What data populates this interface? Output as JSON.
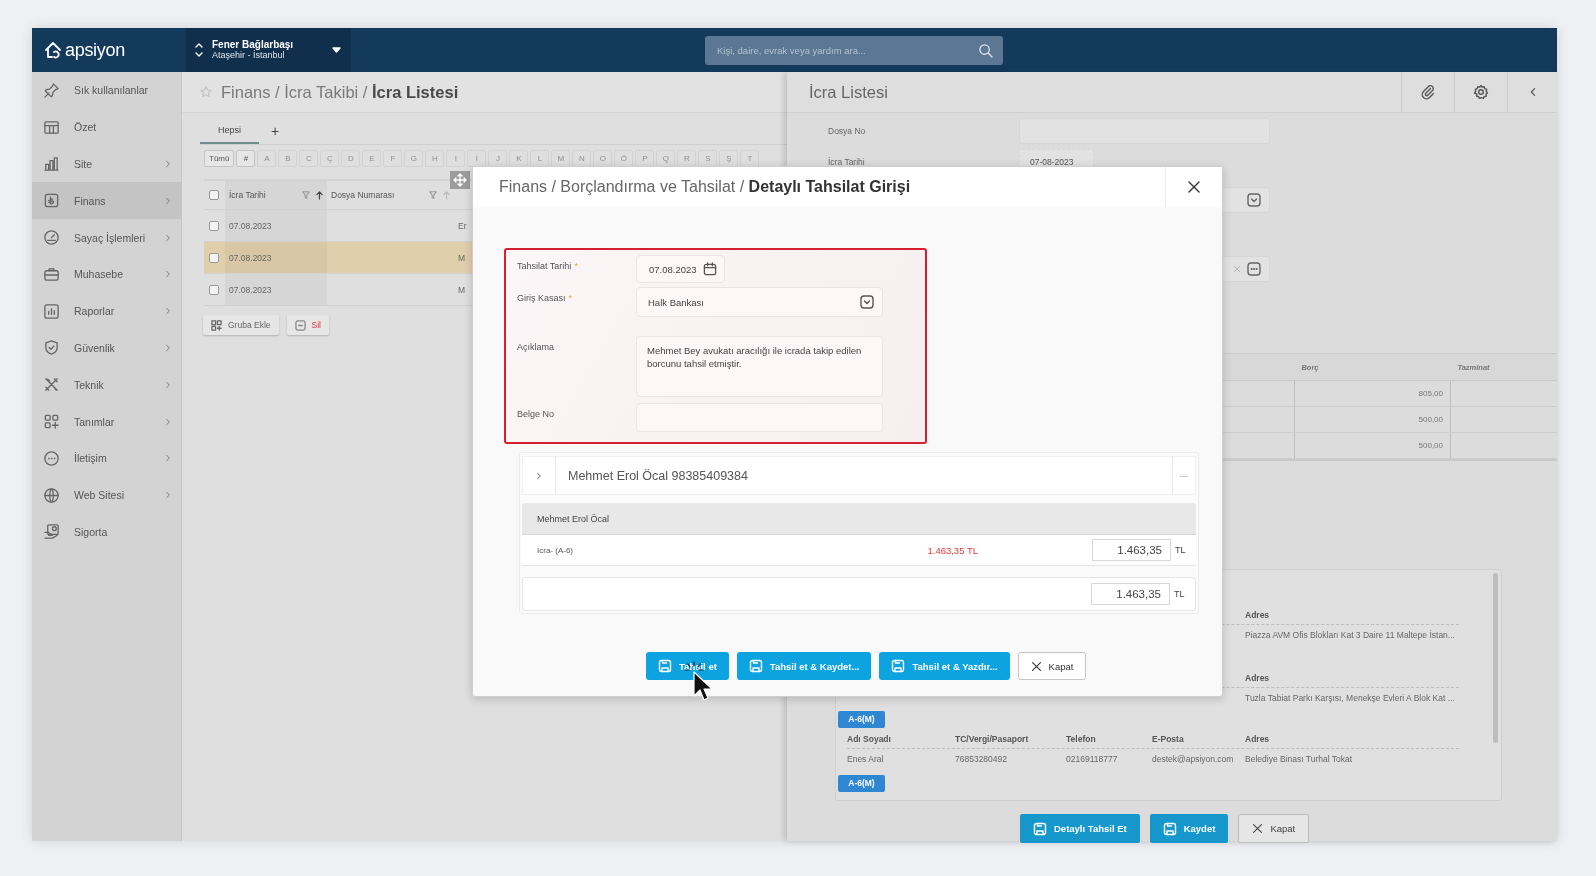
{
  "topbar": {
    "logo": "apsiyon",
    "site": {
      "name": "Fener Bağlarbaşı",
      "location": "Ataşehir - İstanbul"
    },
    "search": {
      "placeholder": "Kişi, daire, evrak veya yardım ara..."
    }
  },
  "sidebar": {
    "items": [
      {
        "label": "Sık kullanılanlar",
        "expandable": false,
        "selected": false
      },
      {
        "label": "Özet",
        "expandable": false,
        "selected": false
      },
      {
        "label": "Site",
        "expandable": true,
        "selected": false
      },
      {
        "label": "Finans",
        "expandable": true,
        "selected": true
      },
      {
        "label": "Sayaç İşlemleri",
        "expandable": true,
        "selected": false
      },
      {
        "label": "Muhasebe",
        "expandable": true,
        "selected": false
      },
      {
        "label": "Raporlar",
        "expandable": true,
        "selected": false
      },
      {
        "label": "Güvenlik",
        "expandable": true,
        "selected": false
      },
      {
        "label": "Teknik",
        "expandable": true,
        "selected": false
      },
      {
        "label": "Tanımlar",
        "expandable": true,
        "selected": false
      },
      {
        "label": "İletişim",
        "expandable": true,
        "selected": false
      },
      {
        "label": "Web Sitesi",
        "expandable": true,
        "selected": false
      },
      {
        "label": "Sigorta",
        "expandable": false,
        "selected": false
      }
    ]
  },
  "list_panel": {
    "breadcrumb": "Finans / İcra Takibi / **İcra Listesi**",
    "tabs": [
      {
        "label": "Hepsi",
        "selected": true
      }
    ],
    "add_tab": "+",
    "letters": [
      {
        "label": "Tümü",
        "disabled": false
      },
      {
        "label": "#",
        "disabled": false
      },
      {
        "label": "A",
        "disabled": true
      },
      {
        "label": "B",
        "disabled": true
      },
      {
        "label": "C",
        "disabled": true
      },
      {
        "label": "Ç",
        "disabled": true
      },
      {
        "label": "D",
        "disabled": true
      },
      {
        "label": "E",
        "disabled": true
      },
      {
        "label": "F",
        "disabled": true
      },
      {
        "label": "G",
        "disabled": true
      },
      {
        "label": "H",
        "disabled": true
      },
      {
        "label": "I",
        "disabled": true
      },
      {
        "label": "İ",
        "disabled": true
      },
      {
        "label": "J",
        "disabled": true
      },
      {
        "label": "K",
        "disabled": true
      },
      {
        "label": "L",
        "disabled": true
      },
      {
        "label": "M",
        "disabled": true
      },
      {
        "label": "N",
        "disabled": true
      },
      {
        "label": "O",
        "disabled": true
      },
      {
        "label": "Ö",
        "disabled": true
      },
      {
        "label": "P",
        "disabled": true
      },
      {
        "label": "Q",
        "disabled": true
      },
      {
        "label": "R",
        "disabled": true
      },
      {
        "label": "S",
        "disabled": true
      },
      {
        "label": "Ş",
        "disabled": true
      },
      {
        "label": "T",
        "disabled": true
      }
    ],
    "table": {
      "select_all": {
        "checked": false
      },
      "columns": [
        "İcra Tarihi",
        "Dosya Numarası"
      ],
      "rows": [
        {
          "date": "07.08.2023",
          "column_3": "Er",
          "checked": false,
          "selected": false
        },
        {
          "date": "07.08.2023",
          "column_3": "M",
          "checked": false,
          "selected": true
        },
        {
          "date": "07.08.2023",
          "column_3": "M",
          "checked": false,
          "selected": false
        }
      ]
    },
    "buttons": [
      {
        "label": "Gruba Ekle",
        "kind": "neutral"
      },
      {
        "label": "Sil",
        "kind": "danger"
      }
    ]
  },
  "detail_panel": {
    "title": "İcra Listesi",
    "fields": [
      {
        "label": "Dosya No"
      },
      {
        "label": "İcra Tarihi",
        "value": "07-08-2023"
      }
    ],
    "table": {
      "columns": [
        "Borç",
        "Tazminat"
      ],
      "rows": [
        {
          "debt": "805,00"
        },
        {
          "debt": "500,00"
        },
        {
          "debt": "500,00"
        }
      ]
    },
    "contacts": [
      {
        "columns": [
          "Adres"
        ],
        "rows": [
          [
            "Piazza AVM Ofis Blokları Kat 3 Daire 11 Maltepe İstan..."
          ]
        ]
      },
      {
        "columns": [
          "Adres"
        ],
        "rows": [
          [
            "Tuzla Tabiat Parkı Karşısı, Menekşe Evleri A Blok Kat ..."
          ]
        ]
      },
      {
        "badge": "A-6(M)",
        "columns": [
          "Adı Soyadı",
          "TC/Vergi/Pasaport",
          "Telefon",
          "E-Posta",
          "Adres"
        ],
        "rows": [
          [
            "Enes Aral",
            "76853280492",
            "02169118777",
            "destek@apsiyon.com",
            "Belediye Binası Turhal Tokat"
          ]
        ]
      },
      {
        "badge": "A-6(M)"
      }
    ],
    "buttons": [
      {
        "label": "Detaylı Tahsil Et",
        "kind": "primary"
      },
      {
        "label": "Kaydet",
        "kind": "primary"
      },
      {
        "label": "Kapat",
        "kind": "secondary"
      }
    ]
  },
  "modal": {
    "title": "Finans / Borçlandırma ve Tahsilat / **Detaylı Tahsilat Girişi**",
    "fields": [
      {
        "label": "Tahsilat Tarihi",
        "marker": "*",
        "kind": "date",
        "value": "07.08.2023"
      },
      {
        "label": "Giriş Kasası",
        "marker": "*",
        "kind": "select",
        "value": "Halk Bankası"
      },
      {
        "label": "Açıklama",
        "kind": "textarea",
        "value": "Mehmet Bey avukatı aracılığı ile icrada takip edilen borcunu tahsil etmiştir."
      },
      {
        "label": "Belge No",
        "kind": "text"
      }
    ],
    "person": {
      "name": "Mehmet Erol Öcal 98385409384",
      "more": "···"
    },
    "debts": {
      "header": "Mehmet Erol Öcal",
      "rows": [
        {
          "label": "İcra- (A-6)",
          "amount": "1.463,35 TL",
          "value": "1.463,35",
          "currency": "TL"
        }
      ],
      "total": {
        "value": "1.463,35",
        "currency": "TL"
      }
    },
    "buttons": [
      {
        "label": "Tahsil et",
        "kind": "primary"
      },
      {
        "label": "Tahsil et & Kaydet...",
        "kind": "primary"
      },
      {
        "label": "Tahsil et & Yazdır...",
        "kind": "primary"
      },
      {
        "label": "Kapat",
        "kind": "secondary"
      }
    ]
  }
}
